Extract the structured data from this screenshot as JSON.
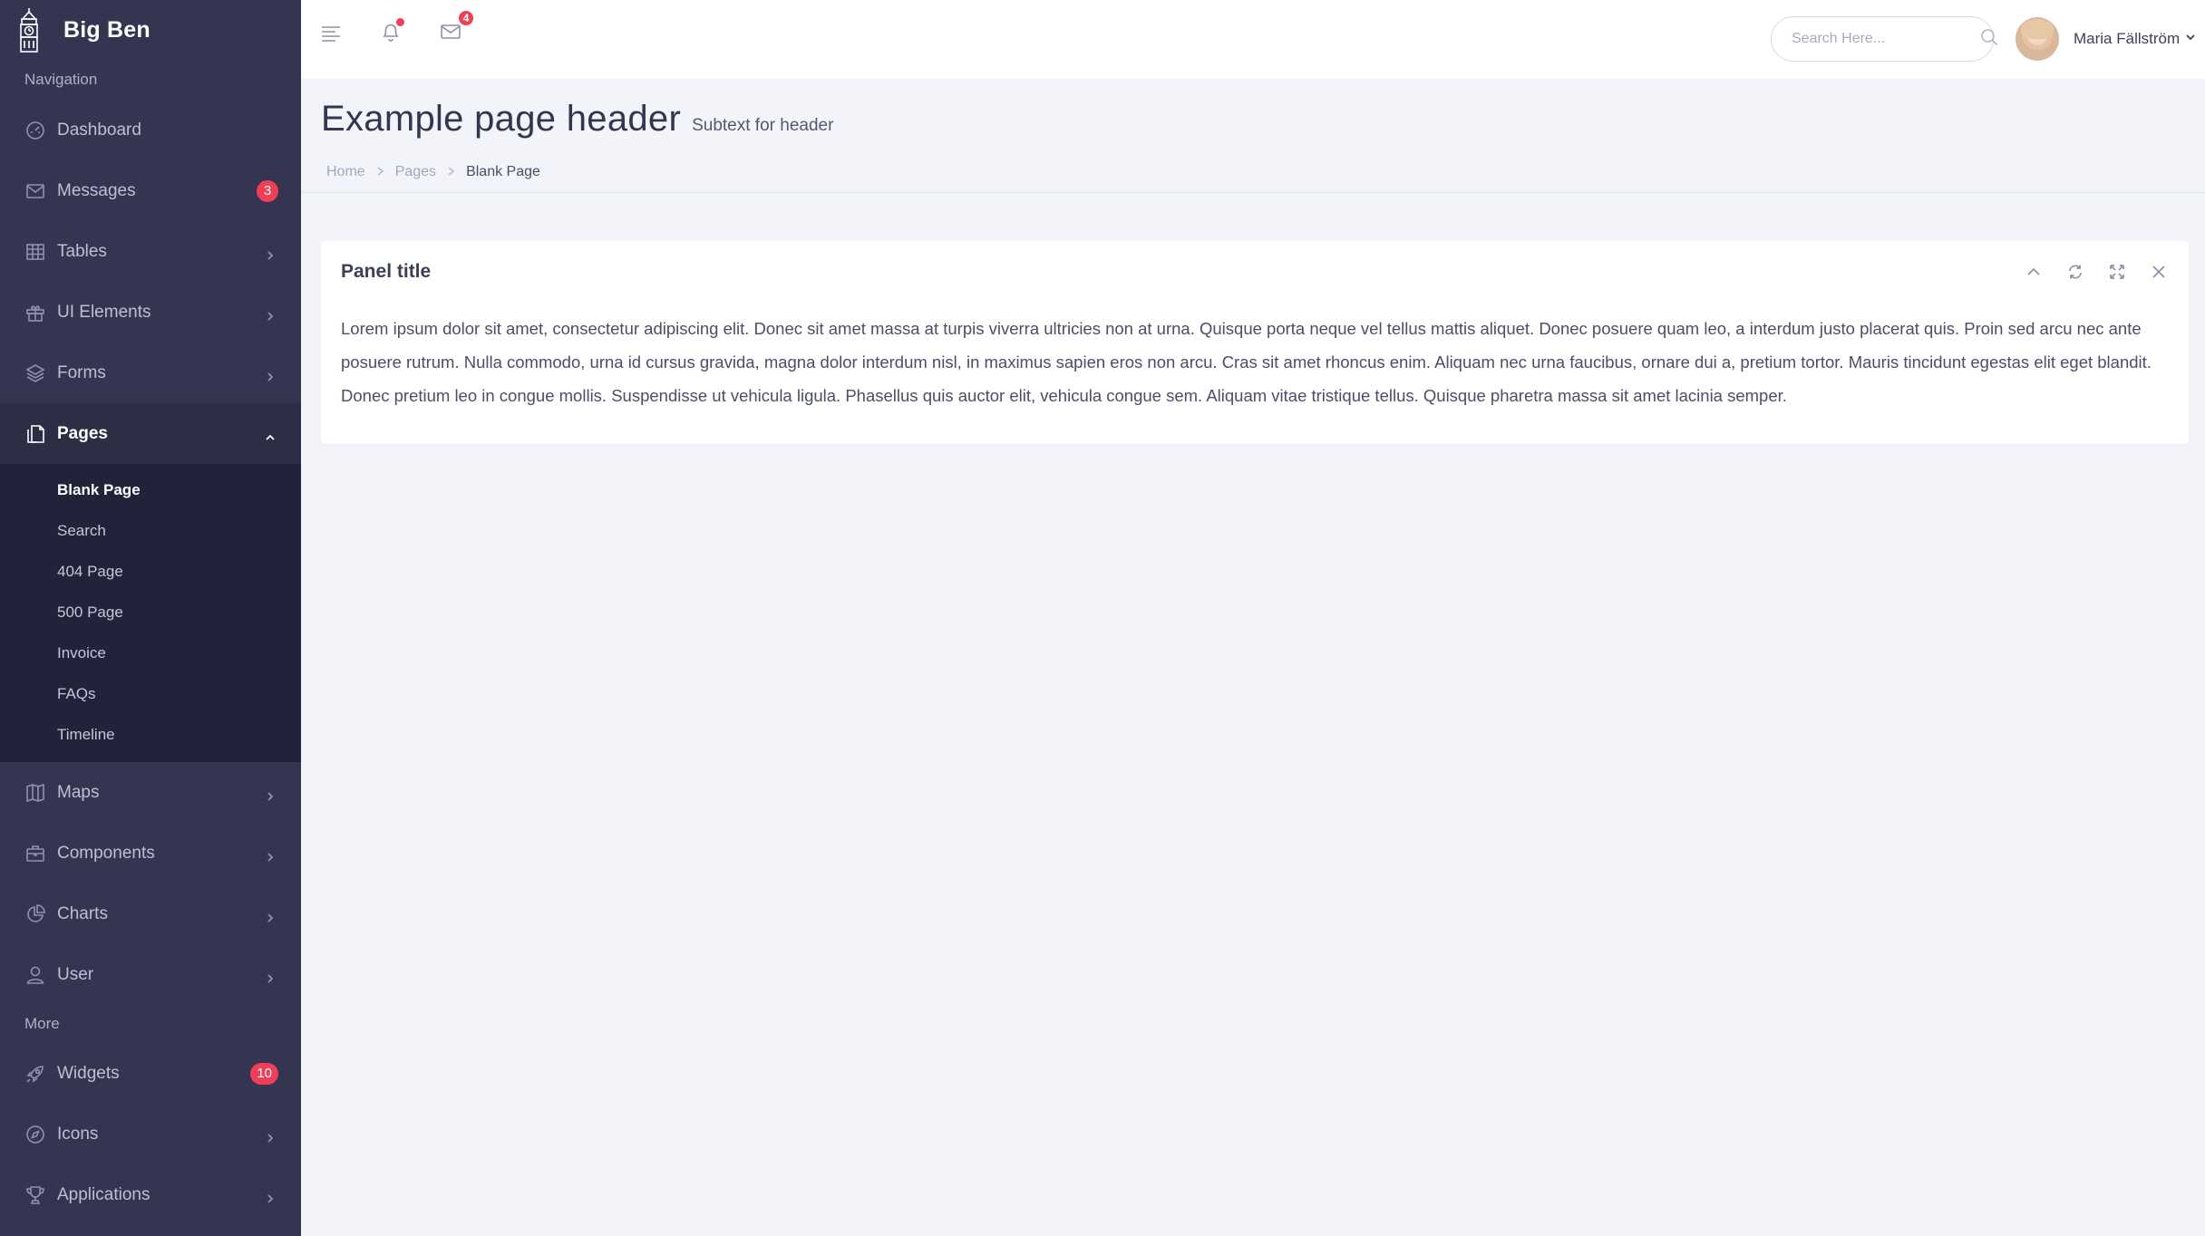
{
  "app": {
    "brand_name": "Big Ben",
    "logo_icon": "big-ben-tower-icon"
  },
  "sidebar": {
    "section_navigation": "Navigation",
    "section_more": "More",
    "items": [
      {
        "label": "Dashboard",
        "icon": "dashboard-icon"
      },
      {
        "label": "Messages",
        "icon": "envelope-icon",
        "badge": "3"
      },
      {
        "label": "Tables",
        "icon": "grid-icon"
      },
      {
        "label": "UI Elements",
        "icon": "gift-icon"
      },
      {
        "label": "Forms",
        "icon": "layers-icon"
      },
      {
        "label": "Pages",
        "icon": "pages-icon",
        "expanded": true
      },
      {
        "label": "Maps",
        "icon": "map-icon"
      },
      {
        "label": "Components",
        "icon": "briefcase-icon"
      },
      {
        "label": "Charts",
        "icon": "pie-chart-icon"
      },
      {
        "label": "User",
        "icon": "user-icon"
      }
    ],
    "pages_submenu": [
      {
        "label": "Blank Page",
        "current": true
      },
      {
        "label": "Search"
      },
      {
        "label": "404 Page"
      },
      {
        "label": "500 Page"
      },
      {
        "label": "Invoice"
      },
      {
        "label": "FAQs"
      },
      {
        "label": "Timeline"
      }
    ],
    "more_items": [
      {
        "label": "Widgets",
        "icon": "rocket-icon",
        "badge": "10"
      },
      {
        "label": "Icons",
        "icon": "compass-icon"
      },
      {
        "label": "Applications",
        "icon": "trophy-icon"
      }
    ]
  },
  "topbar": {
    "mail_count": "4",
    "search_placeholder": "Search Here...",
    "user_name": "Maria Fällström"
  },
  "page": {
    "title": "Example page header",
    "subtitle": "Subtext for header",
    "breadcrumb": [
      "Home",
      "Pages",
      "Blank Page"
    ]
  },
  "panel": {
    "title": "Panel title",
    "body": "Lorem ipsum dolor sit amet, consectetur adipiscing elit. Donec sit amet massa at turpis viverra ultricies non at urna. Quisque porta neque vel tellus mattis aliquet. Donec posuere quam leo, a interdum justo placerat quis. Proin sed arcu nec ante posuere rutrum. Nulla commodo, urna id cursus gravida, magna dolor interdum nisl, in maximus sapien eros non arcu. Cras sit amet rhoncus enim. Aliquam nec urna faucibus, ornare dui a, pretium tortor. Mauris tincidunt egestas elit eget blandit. Donec pretium leo in congue mollis. Suspendisse ut vehicula ligula. Phasellus quis auctor elit, vehicula congue sem. Aliquam vitae tristique tellus. Quisque pharetra massa sit amet lacinia semper."
  },
  "colors": {
    "sidebar_bg": "#353551",
    "sidebar_active_bg": "#2d2d46",
    "submenu_bg": "#22223a",
    "badge_red": "#ef3e56",
    "page_bg": "#f3f4f9"
  }
}
